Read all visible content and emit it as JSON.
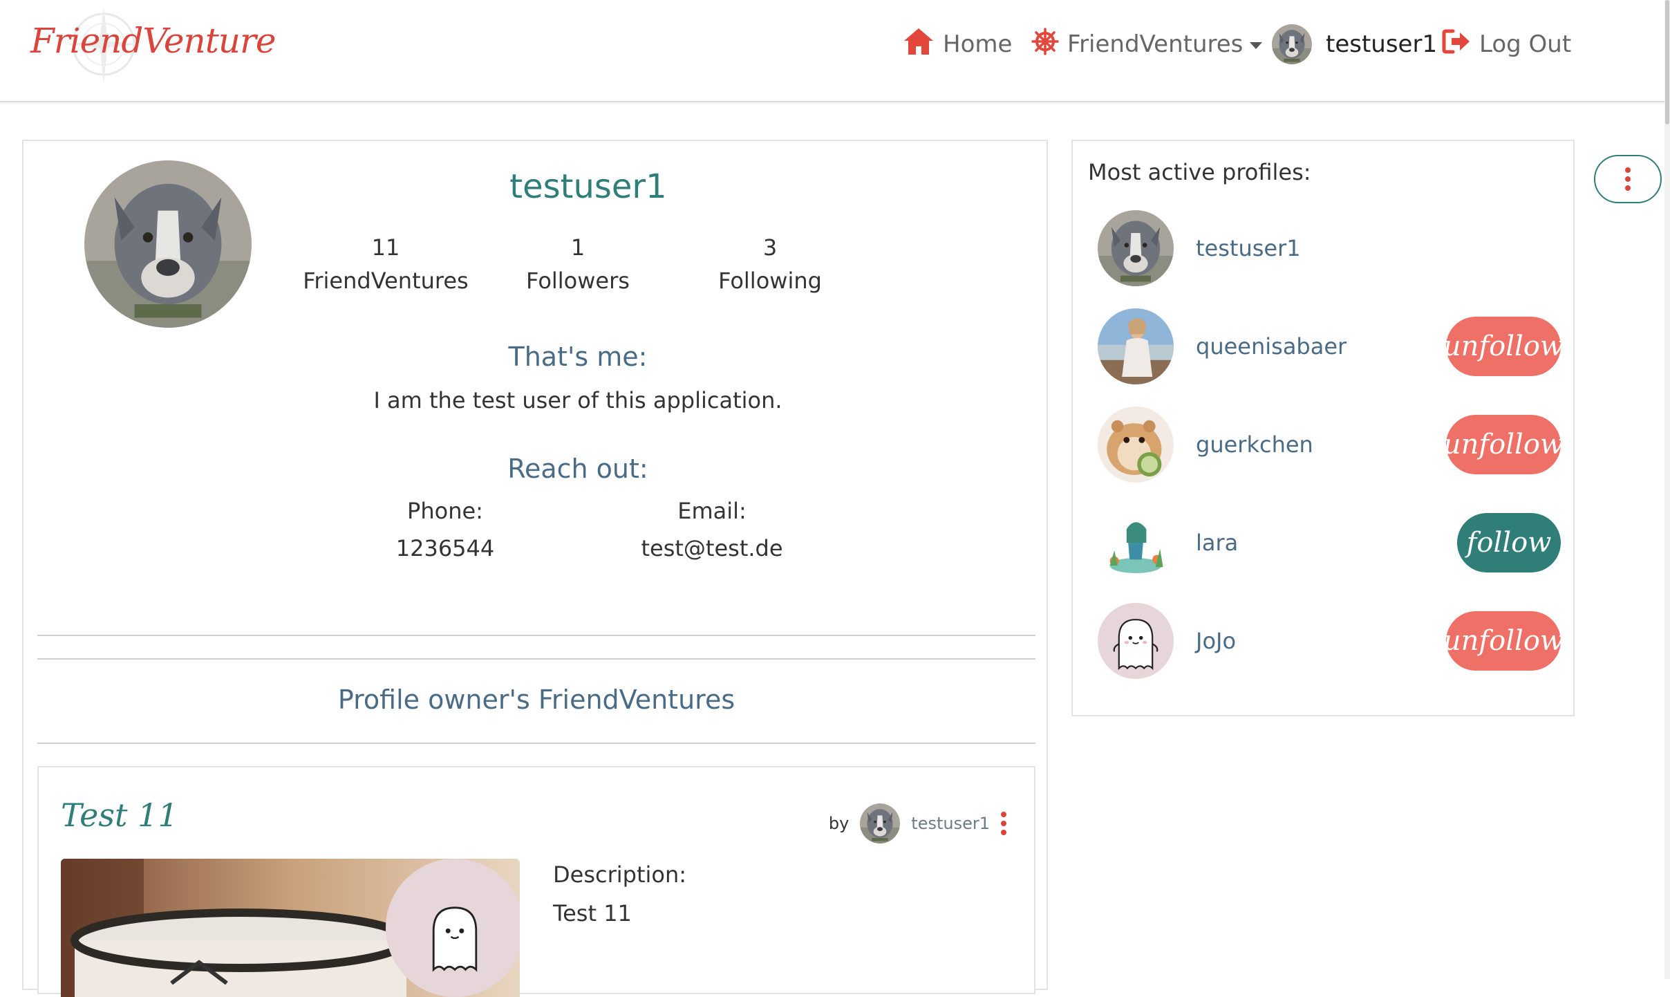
{
  "brand": {
    "logo_text": "FriendVenture"
  },
  "nav": {
    "home": "Home",
    "friendventures": "FriendVentures",
    "user": "testuser1",
    "logout": "Log Out"
  },
  "profile": {
    "username": "testuser1",
    "stats": [
      {
        "value": "11",
        "label": "FriendVentures"
      },
      {
        "value": "1",
        "label": "Followers"
      },
      {
        "value": "3",
        "label": "Following"
      }
    ],
    "about_heading": "That's me:",
    "about_text": "I am the test user of this application.",
    "contact_heading": "Reach out:",
    "phone_label": "Phone:",
    "phone_value": "1236544",
    "email_label": "Email:",
    "email_value": "test@test.de",
    "ventures_heading": "Profile owner's FriendVentures"
  },
  "post": {
    "title": "Test 11",
    "by_label": "by",
    "owner": "testuser1",
    "description_label": "Description:",
    "description": "Test 11"
  },
  "sidebar": {
    "title": "Most active profiles:",
    "profiles": [
      {
        "name": "testuser1",
        "button": ""
      },
      {
        "name": "queenisabaer",
        "button": "unfollow"
      },
      {
        "name": "guerkchen",
        "button": "unfollow"
      },
      {
        "name": "lara",
        "button": "follow"
      },
      {
        "name": "JoJo",
        "button": "unfollow"
      }
    ]
  },
  "colors": {
    "accent_teal": "#2f7e77",
    "accent_red": "#d9443b",
    "unfollow_bg": "#ee7066",
    "heading_blue": "#4a6b86"
  }
}
